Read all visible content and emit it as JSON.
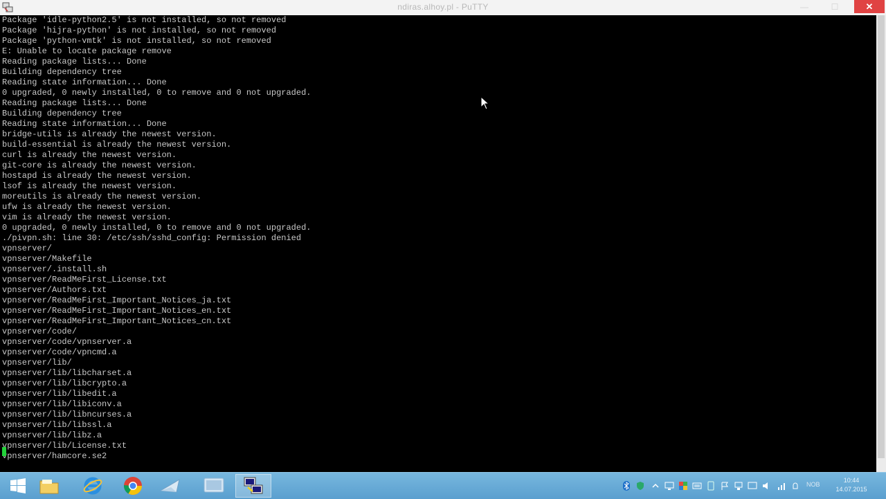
{
  "window": {
    "title": "ndiras.alhoy.pl - PuTTY",
    "close_label": "✕",
    "minimize_label": "—",
    "maximize_label": "☐"
  },
  "terminal": {
    "lines": [
      "Package 'idle-python2.5' is not installed, so not removed",
      "Package 'hijra-python' is not installed, so not removed",
      "Package 'python-vmtk' is not installed, so not removed",
      "E: Unable to locate package remove",
      "Reading package lists... Done",
      "Building dependency tree",
      "Reading state information... Done",
      "0 upgraded, 0 newly installed, 0 to remove and 0 not upgraded.",
      "Reading package lists... Done",
      "Building dependency tree",
      "Reading state information... Done",
      "bridge-utils is already the newest version.",
      "build-essential is already the newest version.",
      "curl is already the newest version.",
      "git-core is already the newest version.",
      "hostapd is already the newest version.",
      "lsof is already the newest version.",
      "moreutils is already the newest version.",
      "ufw is already the newest version.",
      "vim is already the newest version.",
      "0 upgraded, 0 newly installed, 0 to remove and 0 not upgraded.",
      "./pivpn.sh: line 30: /etc/ssh/sshd_config: Permission denied",
      "vpnserver/",
      "vpnserver/Makefile",
      "vpnserver/.install.sh",
      "vpnserver/ReadMeFirst_License.txt",
      "vpnserver/Authors.txt",
      "vpnserver/ReadMeFirst_Important_Notices_ja.txt",
      "vpnserver/ReadMeFirst_Important_Notices_en.txt",
      "vpnserver/ReadMeFirst_Important_Notices_cn.txt",
      "vpnserver/code/",
      "vpnserver/code/vpnserver.a",
      "vpnserver/code/vpncmd.a",
      "vpnserver/lib/",
      "vpnserver/lib/libcharset.a",
      "vpnserver/lib/libcrypto.a",
      "vpnserver/lib/libedit.a",
      "vpnserver/lib/libiconv.a",
      "vpnserver/lib/libncurses.a",
      "vpnserver/lib/libssl.a",
      "vpnserver/lib/libz.a",
      "vpnserver/lib/License.txt",
      "vpnserver/hamcore.se2"
    ],
    "text_color": "#c8c8c8",
    "cursor_color": "#23d33a"
  },
  "taskbar": {
    "items": [
      "windows-start",
      "file-explorer",
      "internet-explorer",
      "chrome",
      "mail",
      "remote-desktop",
      "putty"
    ],
    "active_item": "putty",
    "tray": {
      "language": "NOB",
      "time": "10:44",
      "date": "14.07.2015"
    }
  }
}
